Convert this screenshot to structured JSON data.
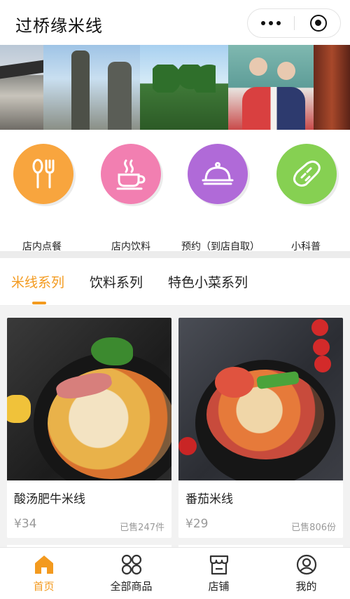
{
  "header": {
    "title": "过桥缘米线"
  },
  "capsule": {
    "more_icon": "more-dots-icon",
    "close_icon": "target-icon"
  },
  "categories": [
    {
      "label": "店内点餐",
      "icon": "spoon-fork-icon",
      "color": "#f8a53e"
    },
    {
      "label": "店内饮料",
      "icon": "coffee-cup-icon",
      "color": "#f27fb1"
    },
    {
      "label": "预约（到店自取）",
      "icon": "food-cloche-icon",
      "color": "#b06ad8"
    },
    {
      "label": "小科普",
      "icon": "bread-icon",
      "color": "#86d052"
    }
  ],
  "tabs": [
    {
      "label": "米线系列",
      "active": true
    },
    {
      "label": "饮料系列",
      "active": false
    },
    {
      "label": "特色小菜系列",
      "active": false
    }
  ],
  "products": [
    {
      "name": "酸汤肥牛米线",
      "price": "¥34",
      "sold": "已售247件"
    },
    {
      "name": "番茄米线",
      "price": "¥29",
      "sold": "已售806份"
    }
  ],
  "nav": [
    {
      "label": "首页",
      "icon": "home-icon",
      "active": true
    },
    {
      "label": "全部商品",
      "icon": "grid-icon",
      "active": false
    },
    {
      "label": "店铺",
      "icon": "store-icon",
      "active": false
    },
    {
      "label": "我的",
      "icon": "user-icon",
      "active": false
    }
  ],
  "colors": {
    "accent": "#f39a1f",
    "text": "#222222",
    "muted": "#999999"
  }
}
